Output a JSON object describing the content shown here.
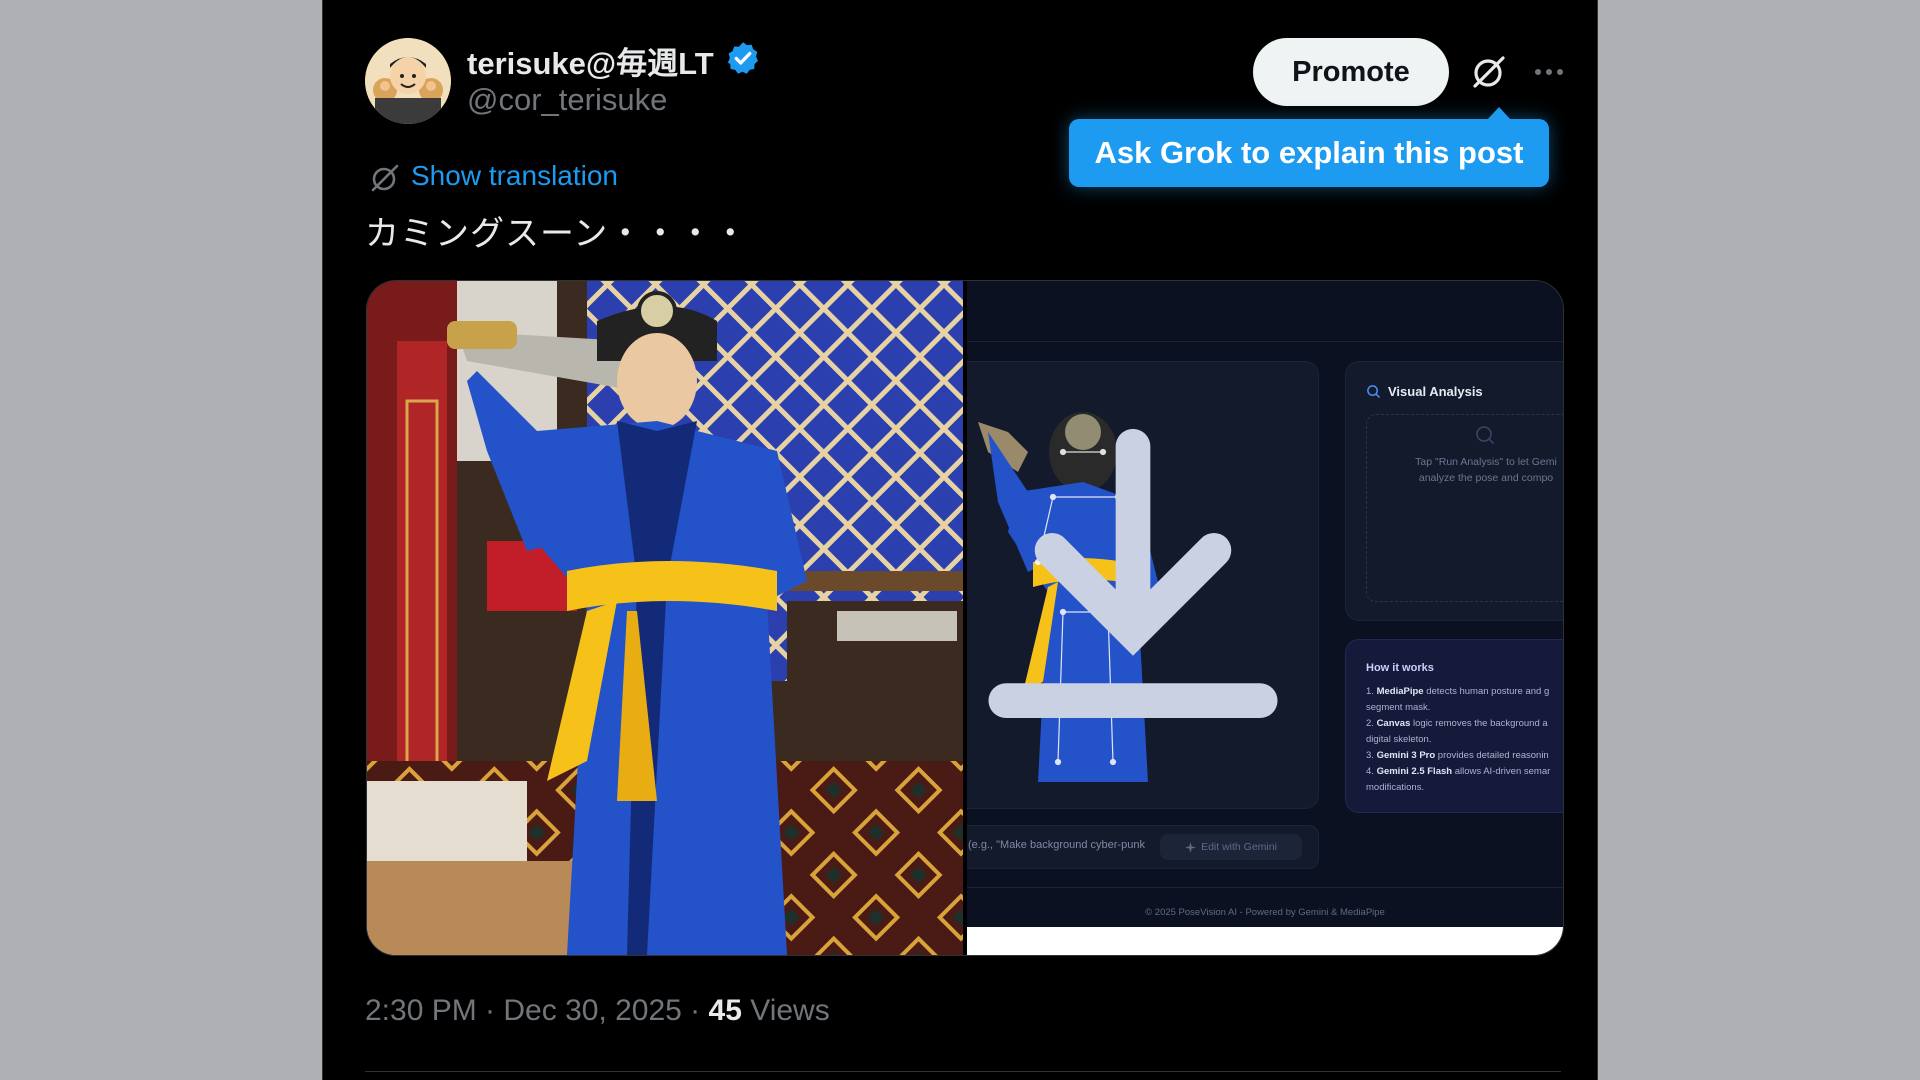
{
  "author": {
    "display_name": "terisuke@毎週LT",
    "handle": "@cor_terisuke",
    "verified": true
  },
  "actions": {
    "promote_label": "Promote",
    "grok_tooltip": "Ask Grok to explain this post"
  },
  "post": {
    "show_translation": "Show translation",
    "text": "カミングスーン・・・・",
    "timestamp": "2:30 PM · Dec 30, 2025 · ",
    "views_count": "45",
    "views_label": " Views"
  },
  "media": {
    "screenshot": {
      "analysis_title": "Visual Analysis",
      "analysis_empty_line1": "Tap \"Run Analysis\" to let Gemi",
      "analysis_empty_line2": "analyze the pose and compo",
      "how_title": "How it works",
      "how_items": [
        {
          "bold": "MediaPipe",
          "rest": " detects human posture and g",
          "num": "1. "
        },
        {
          "bold": "",
          "rest": "segment mask.",
          "num": ""
        },
        {
          "bold": "Canvas",
          "rest": " logic removes the background a",
          "num": "2. "
        },
        {
          "bold": "",
          "rest": "digital skeleton.",
          "num": ""
        },
        {
          "bold": "Gemini 3 Pro",
          "rest": " provides detailed reasonin",
          "num": "3. "
        },
        {
          "bold": "Gemini 2.5 Flash",
          "rest": " allows AI-driven semar",
          "num": "4. "
        },
        {
          "bold": "",
          "rest": "modifications.",
          "num": ""
        }
      ],
      "input_placeholder": "(e.g., \"Make background cyber-punk",
      "edit_button": "Edit with Gemini",
      "footer": "© 2025 PoseVision AI - Powered by Gemini & MediaPipe"
    }
  },
  "colors": {
    "accent": "#1d9bf0",
    "background": "#000000",
    "muted_text": "#71767b",
    "primary_text": "#e7e9ea"
  },
  "icons": [
    "verified-badge-icon",
    "grok-icon",
    "more-icon",
    "translate-icon",
    "download-icon",
    "search-icon",
    "sparkle-icon"
  ]
}
